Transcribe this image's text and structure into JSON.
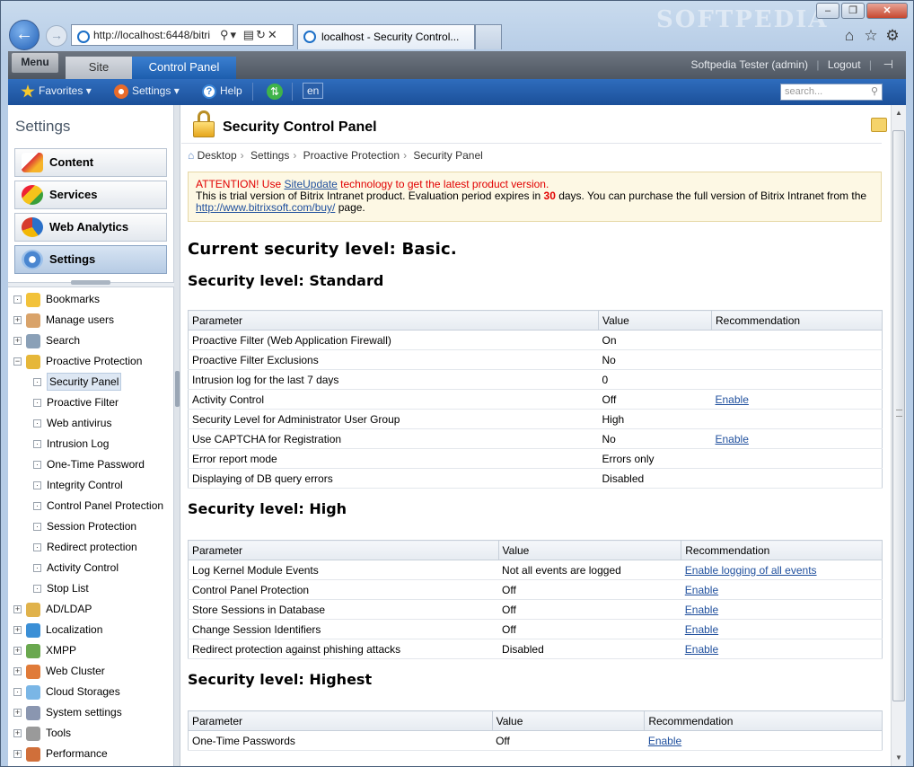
{
  "browser": {
    "address_url": "http://localhost:6448/bitri",
    "tab_title": "localhost - Security Control...",
    "watermark": "SOFTPEDIA",
    "window_controls": [
      "–",
      "❐",
      "✕"
    ]
  },
  "panel": {
    "menu_label": "Menu",
    "tabs": [
      "Site",
      "Control Panel"
    ],
    "user": "Softpedia Tester (admin)",
    "logout": "Logout",
    "toolbar": {
      "favorites": "Favorites",
      "settings": "Settings",
      "help": "Help",
      "lang": "en",
      "search_placeholder": "search..."
    }
  },
  "sidebar": {
    "title": "Settings",
    "sections": [
      "Content",
      "Services",
      "Web Analytics",
      "Settings"
    ],
    "tree": [
      {
        "label": "Bookmarks",
        "level": 0,
        "exp": "·",
        "icon": "star-icon",
        "color": "#f2c23a"
      },
      {
        "label": "Manage users",
        "level": 0,
        "exp": "+",
        "icon": "users-icon",
        "color": "#d9a36a"
      },
      {
        "label": "Search",
        "level": 0,
        "exp": "+",
        "icon": "magnifier-icon",
        "color": "#8aa0b7"
      },
      {
        "label": "Proactive Protection",
        "level": 0,
        "exp": "−",
        "icon": "lock-icon",
        "color": "#e6b739"
      },
      {
        "label": "Security Panel",
        "level": 1,
        "exp": "·",
        "selected": true
      },
      {
        "label": "Proactive Filter",
        "level": 1,
        "exp": "·"
      },
      {
        "label": "Web antivirus",
        "level": 1,
        "exp": "·"
      },
      {
        "label": "Intrusion Log",
        "level": 1,
        "exp": "·"
      },
      {
        "label": "One-Time Password",
        "level": 1,
        "exp": "·"
      },
      {
        "label": "Integrity Control",
        "level": 1,
        "exp": "·"
      },
      {
        "label": "Control Panel Protection",
        "level": 1,
        "exp": "·"
      },
      {
        "label": "Session Protection",
        "level": 1,
        "exp": "·"
      },
      {
        "label": "Redirect protection",
        "level": 1,
        "exp": "·"
      },
      {
        "label": "Activity Control",
        "level": 1,
        "exp": "·"
      },
      {
        "label": "Stop List",
        "level": 1,
        "exp": "·"
      },
      {
        "label": "AD/LDAP",
        "level": 0,
        "exp": "+",
        "icon": "ldap-icon",
        "color": "#e0b24b"
      },
      {
        "label": "Localization",
        "level": 0,
        "exp": "+",
        "icon": "globe-icon",
        "color": "#3b8fd6"
      },
      {
        "label": "XMPP",
        "level": 0,
        "exp": "+",
        "icon": "xmpp-icon",
        "color": "#6aa84f"
      },
      {
        "label": "Web Cluster",
        "level": 0,
        "exp": "+",
        "icon": "cluster-icon",
        "color": "#e07b39"
      },
      {
        "label": "Cloud Storages",
        "level": 0,
        "exp": "·",
        "icon": "cloud-icon",
        "color": "#7ab6e6"
      },
      {
        "label": "System settings",
        "level": 0,
        "exp": "+",
        "icon": "gear-icon",
        "color": "#8a96b0"
      },
      {
        "label": "Tools",
        "level": 0,
        "exp": "+",
        "icon": "tools-icon",
        "color": "#9a9a9a"
      },
      {
        "label": "Performance",
        "level": 0,
        "exp": "+",
        "icon": "gauge-icon",
        "color": "#d06f3a"
      }
    ]
  },
  "main": {
    "title": "Security Control Panel",
    "breadcrumbs": [
      "Desktop",
      "Settings",
      "Proactive Protection",
      "Security Panel"
    ],
    "notice": {
      "attention_prefix": "ATTENTION! Use ",
      "attention_link": "SiteUpdate",
      "attention_suffix": " technology to get the latest product version.",
      "trial_prefix": "This is trial version of Bitrix Intranet product. Evaluation period expires in ",
      "days": "30",
      "trial_suffix": " days. You can purchase the full version of Bitrix Intranet from the ",
      "buy_link": "http://www.bitrixsoft.com/buy/",
      "trial_end": " page."
    },
    "current_level": "Current security level: Basic.",
    "columns": [
      "Parameter",
      "Value",
      "Recommendation"
    ],
    "levels": [
      {
        "heading": "Security level: Standard",
        "rows": [
          [
            "Proactive Filter (Web Application Firewall)",
            "On",
            ""
          ],
          [
            "Proactive Filter Exclusions",
            "No",
            ""
          ],
          [
            "Intrusion log for the last 7 days",
            "0",
            ""
          ],
          [
            "Activity Control",
            "Off",
            "Enable"
          ],
          [
            "Security Level for Administrator User Group",
            "High",
            ""
          ],
          [
            "Use CAPTCHA for Registration",
            "No",
            "Enable"
          ],
          [
            "Error report mode",
            "Errors only",
            ""
          ],
          [
            "Displaying of DB query errors",
            "Disabled",
            ""
          ]
        ]
      },
      {
        "heading": "Security level: High",
        "rows": [
          [
            "Log Kernel Module Events",
            "Not all events are logged",
            "Enable logging of all events"
          ],
          [
            "Control Panel Protection",
            "Off",
            "Enable"
          ],
          [
            "Store Sessions in Database",
            "Off",
            "Enable"
          ],
          [
            "Change Session Identifiers",
            "Off",
            "Enable"
          ],
          [
            "Redirect protection against phishing attacks",
            "Disabled",
            "Enable"
          ]
        ]
      },
      {
        "heading": "Security level: Highest",
        "rows": [
          [
            "One-Time Passwords",
            "Off",
            "Enable"
          ]
        ]
      }
    ]
  }
}
